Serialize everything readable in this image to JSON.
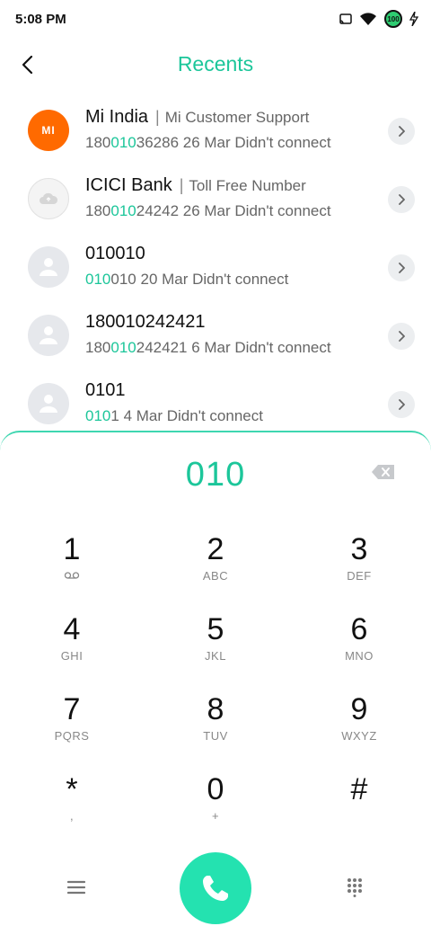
{
  "status_bar": {
    "time": "5:08 PM",
    "battery": "100",
    "icons": [
      "cast-icon",
      "wifi-icon",
      "battery-icon",
      "charging-icon"
    ]
  },
  "header": {
    "title": "Recents",
    "back_icon": "chevron-left-icon"
  },
  "recents": [
    {
      "name": "Mi India",
      "label": "Mi Customer Support",
      "number_pre": "180",
      "number_match": "010",
      "number_post": "36286",
      "meta": "26 Mar Didn't connect",
      "avatar": "mi-logo",
      "avatar_text": "MI"
    },
    {
      "name": "ICICI Bank",
      "label": "Toll Free Number",
      "number_pre": "180",
      "number_match": "010",
      "number_post": "24242",
      "meta": "26 Mar Didn't connect",
      "avatar": "cloud-icon"
    },
    {
      "name": "010010",
      "label": "",
      "number_pre": "",
      "number_match": "010",
      "number_post": "010",
      "meta": "20 Mar Didn't connect",
      "avatar": "person-icon"
    },
    {
      "name": "180010242421",
      "label": "",
      "number_pre": "180",
      "number_match": "010",
      "number_post": "242421",
      "meta": "6 Mar Didn't connect",
      "avatar": "person-icon"
    },
    {
      "name": "0101",
      "label": "",
      "number_pre": "",
      "number_match": "010",
      "number_post": "1",
      "meta": "4 Mar Didn't connect",
      "avatar": "person-icon"
    }
  ],
  "dialer": {
    "entered_number": "010",
    "keys": [
      {
        "digit": "1",
        "letters": "",
        "sub_icon": "voicemail-icon"
      },
      {
        "digit": "2",
        "letters": "ABC"
      },
      {
        "digit": "3",
        "letters": "DEF"
      },
      {
        "digit": "4",
        "letters": "GHI"
      },
      {
        "digit": "5",
        "letters": "JKL"
      },
      {
        "digit": "6",
        "letters": "MNO"
      },
      {
        "digit": "7",
        "letters": "PQRS"
      },
      {
        "digit": "8",
        "letters": "TUV"
      },
      {
        "digit": "9",
        "letters": "WXYZ"
      },
      {
        "digit": "*",
        "letters": ","
      },
      {
        "digit": "0",
        "letters": "+"
      },
      {
        "digit": "#",
        "letters": ""
      }
    ]
  },
  "colors": {
    "accent": "#1cc69a",
    "call_button": "#24e2b0",
    "mi_orange": "#ff6a00"
  }
}
